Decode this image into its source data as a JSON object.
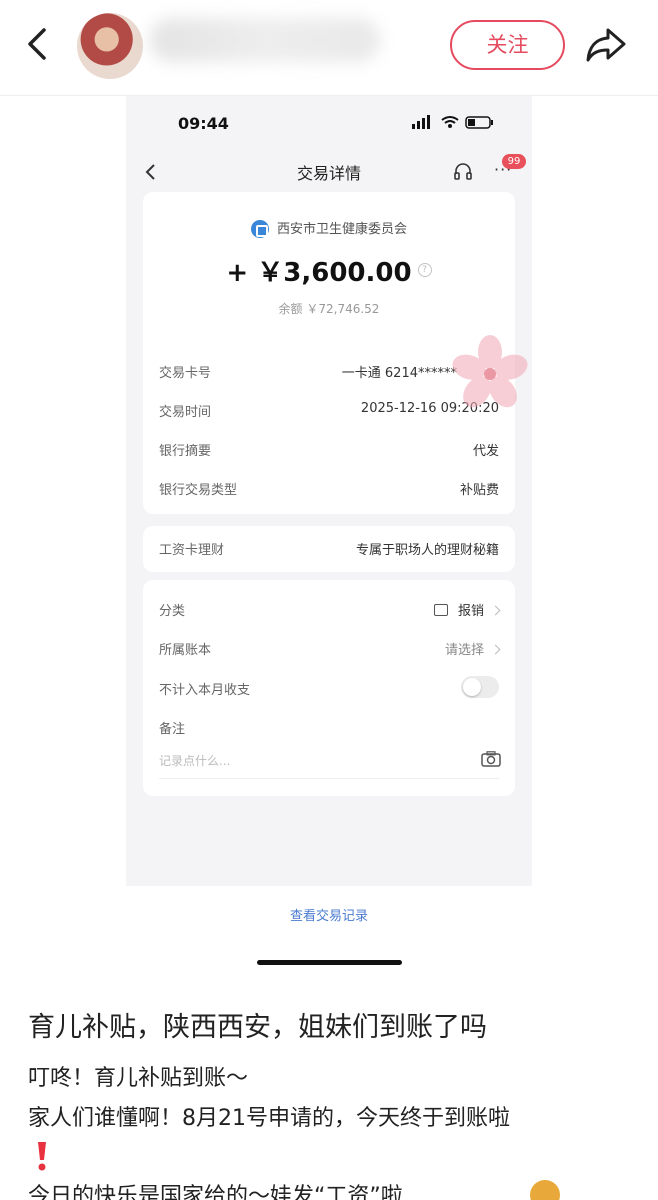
{
  "header": {
    "follow_label": "关注"
  },
  "screenshot": {
    "status_time": "09:44",
    "nav_title": "交易详情",
    "badge_count": "99",
    "more_dots": "···",
    "payer": "西安市卫生健康委员会",
    "amount": "+ ￥3,600.00",
    "balance": "余额 ￥72,746.52",
    "details": [
      {
        "label": "交易卡号",
        "value": "一卡通 6214******"
      },
      {
        "label": "交易时间",
        "value": "2025-12-16 09:20:20"
      },
      {
        "label": "银行摘要",
        "value": "代发"
      },
      {
        "label": "银行交易类型",
        "value": "补贴费"
      }
    ],
    "promo": {
      "label": "工资卡理财",
      "value": "专属于职场人的理财秘籍"
    },
    "settings": {
      "category_label": "分类",
      "category_value": "报销",
      "account_label": "所属账本",
      "account_value": "请选择",
      "exclude_label": "不计入本月收支",
      "exclude_on": false,
      "memo_label": "备注",
      "memo_placeholder": "记录点什么..."
    },
    "view_records_link": "查看交易记录"
  },
  "post": {
    "title": "育儿补贴，陕西西安，姐妹们到账了吗",
    "lines": [
      "叮咚！育儿补贴到账～",
      "家人们谁懂啊！8月21号申请的，今天终于到账啦",
      "今日的快乐是国家给的～娃发“工资”啦"
    ]
  },
  "colors": {
    "accent_red": "#e64a5f",
    "link_blue": "#4a7bd0",
    "badge_red": "#e8505b"
  }
}
